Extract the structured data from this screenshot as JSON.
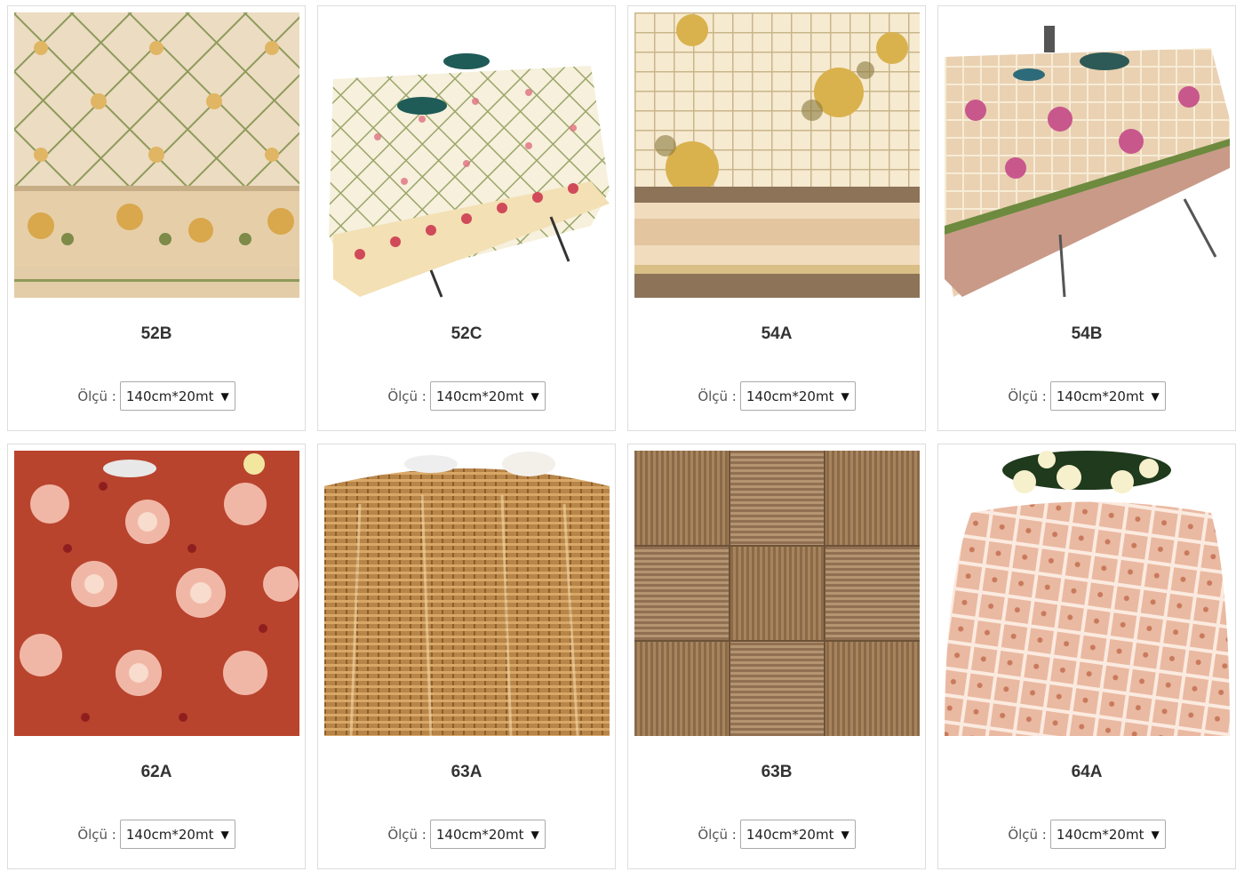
{
  "products": [
    {
      "code": "52B",
      "size_label": "Ölçü :",
      "size_value": "140cm*20mt",
      "image": "tablecloth-52b"
    },
    {
      "code": "52C",
      "size_label": "Ölçü :",
      "size_value": "140cm*20mt",
      "image": "tablecloth-52c"
    },
    {
      "code": "54A",
      "size_label": "Ölçü :",
      "size_value": "140cm*20mt",
      "image": "tablecloth-54a"
    },
    {
      "code": "54B",
      "size_label": "Ölçü :",
      "size_value": "140cm*20mt",
      "image": "tablecloth-54b"
    },
    {
      "code": "62A",
      "size_label": "Ölçü :",
      "size_value": "140cm*20mt",
      "image": "tablecloth-62a"
    },
    {
      "code": "63A",
      "size_label": "Ölçü :",
      "size_value": "140cm*20mt",
      "image": "tablecloth-63a"
    },
    {
      "code": "63B",
      "size_label": "Ölçü :",
      "size_value": "140cm*20mt",
      "image": "tablecloth-63b"
    },
    {
      "code": "64A",
      "size_label": "Ölçü :",
      "size_value": "140cm*20mt",
      "image": "tablecloth-64a"
    }
  ],
  "icons": {
    "dropdown": "chevron-down-icon"
  },
  "colors": {
    "border": "#dddddd",
    "text": "#333333"
  }
}
